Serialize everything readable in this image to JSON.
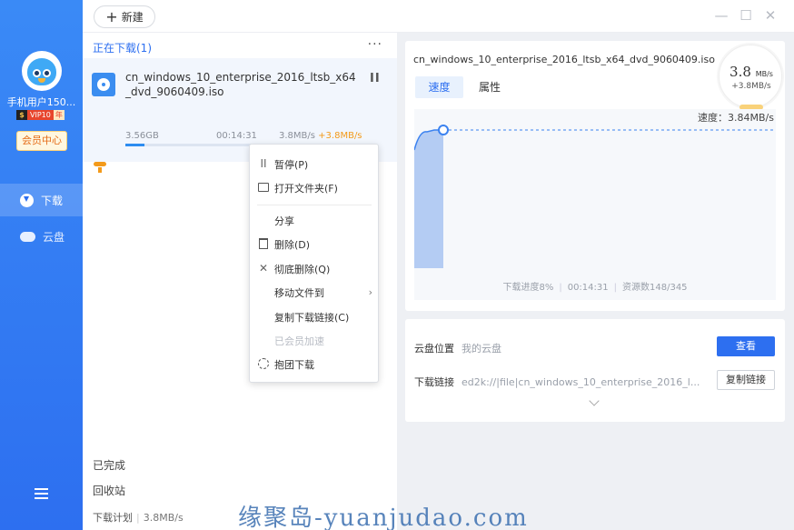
{
  "sidebar": {
    "username": "手机用户150...",
    "vip_s": "$",
    "vip_label": "VIP10",
    "vip_year": "年",
    "member_center": "会员中心",
    "nav": [
      {
        "label": "下载"
      },
      {
        "label": "云盘"
      }
    ]
  },
  "topbar": {
    "new_label": "新建",
    "new_plus": "+",
    "minimize": "—",
    "maximize": "☐",
    "close": "✕"
  },
  "list": {
    "downloading_title": "正在下载(1)",
    "more": "···",
    "task": {
      "name": "cn_windows_10_enterprise_2016_ltsb_x64_dvd_9060409.iso",
      "size": "3.56GB",
      "time": "00:14:31",
      "speed": "3.8MB/s",
      "accel": "+3.8MB/s",
      "progress": 0.08,
      "pause": "II"
    },
    "completed": "已完成",
    "recycle": "回收站",
    "plan_label": "下载计划",
    "plan_sep": "|",
    "plan_rate": "3.8MB/s"
  },
  "context_menu": {
    "items": [
      {
        "icon": "II",
        "label": "暂停(P)"
      },
      {
        "icon": "",
        "label": "打开文件夹(F)"
      },
      {
        "icon": "",
        "label": "分享"
      },
      {
        "icon": "",
        "label": "删除(D)"
      },
      {
        "icon": "✕",
        "label": "彻底删除(Q)"
      },
      {
        "icon": "",
        "label": "移动文件到",
        "arrow": "›"
      },
      {
        "icon": "",
        "label": "复制下载链接(C)"
      },
      {
        "icon": "",
        "label": "已会员加速"
      },
      {
        "icon": "",
        "label": "抱团下载"
      }
    ]
  },
  "detail": {
    "file_name": "cn_windows_10_enterprise_2016_ltsb_x64_dvd_9060409.iso",
    "tab_speed": "速度",
    "tab_props": "属性",
    "speed_main": "3.8",
    "speed_unit": "MB/s",
    "speed_accel": "+3.8MB/s",
    "speed_label": "速度：3.84MB/s",
    "footer_progress": "下载进度8%",
    "footer_sep": "|",
    "footer_time": "00:14:31",
    "footer_sources": "资源数148/345"
  },
  "cloud": {
    "location_label": "云盘位置",
    "location_value": "我的云盘",
    "view_btn": "查看",
    "link_label": "下载链接",
    "link_value": "ed2k://|file|cn_windows_10_enterprise_2016_l...",
    "copy_btn": "复制链接"
  },
  "watermark": "缘聚岛-yuanjudao.com",
  "colors": {
    "accent": "#2d6ff0",
    "accel": "#f39a1a"
  }
}
